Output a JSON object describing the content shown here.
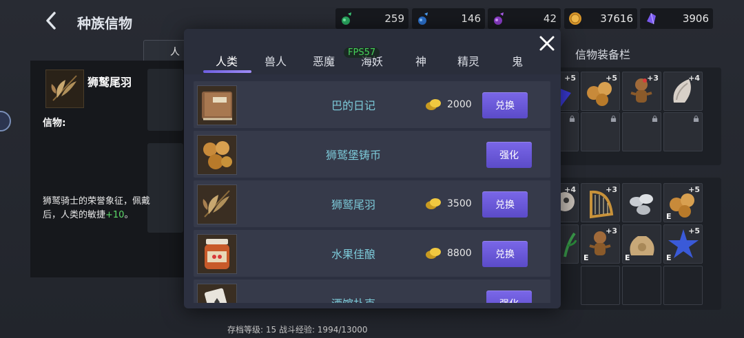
{
  "header": {
    "title": "种族信物"
  },
  "resources": [
    {
      "icon": "green-potion-icon",
      "value": "259"
    },
    {
      "icon": "blue-potion-icon",
      "value": "146"
    },
    {
      "icon": "purple-potion-icon",
      "value": "42"
    },
    {
      "icon": "gold-coin-icon",
      "value": "37616"
    },
    {
      "icon": "purple-crystal-icon",
      "value": "3906"
    }
  ],
  "background_tabs": {
    "human": "人"
  },
  "detail": {
    "name": "狮鹫尾羽",
    "faith_label": "信物:",
    "desc_prefix": "狮鹫骑士的荣誉象征，佩戴后，人类的敏捷",
    "desc_bonus": "+10",
    "desc_suffix": "。"
  },
  "equip": {
    "title": "信物装备栏"
  },
  "footer": {
    "text": "存档等级: 15  战斗经验: 1994/13000"
  },
  "modal": {
    "fps": "FPS57",
    "tabs": [
      "人类",
      "兽人",
      "恶魔",
      "海妖",
      "神",
      "精灵",
      "鬼"
    ],
    "active_tab": 0,
    "rows": [
      {
        "name": "巴的日记",
        "price": "2000",
        "button": "兑换",
        "icon": "diary-book-icon"
      },
      {
        "name": "狮鹫堡铸币",
        "price": "",
        "button": "强化",
        "icon": "coins-icon"
      },
      {
        "name": "狮鹫尾羽",
        "price": "3500",
        "button": "兑换",
        "icon": "feather-icon"
      },
      {
        "name": "水果佳酿",
        "price": "8800",
        "button": "兑换",
        "icon": "jam-jar-icon"
      },
      {
        "name": "酒馆扑克",
        "price": "",
        "button": "强化",
        "icon": "playing-card-icon"
      }
    ]
  },
  "colors": {
    "accent": "#6e5fe0",
    "highlight": "#5ddc6a",
    "item_name": "#7cc9d8"
  }
}
